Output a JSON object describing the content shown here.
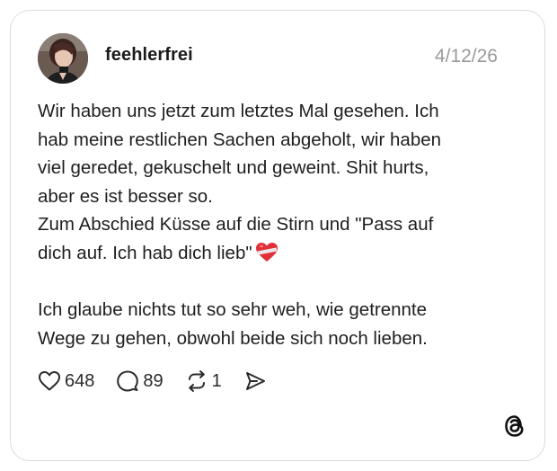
{
  "post": {
    "username": "feehlerfrei",
    "date": "4/12/26",
    "avatar_icon": "profile-photo",
    "lines": [
      "Wir haben uns jetzt zum letztes Mal gesehen. Ich",
      "hab meine restlichen Sachen abgeholt, wir haben",
      "viel geredet, gekuschelt und geweint. Shit hurts,",
      "aber es ist besser so.",
      "Zum Abschied Küsse auf die Stirn und \"Pass auf",
      "dich auf. Ich hab dich lieb\"",
      "",
      "Ich glaube nichts tut so sehr weh, wie getrennte",
      "Wege zu gehen, obwohl beide sich noch lieben."
    ],
    "emoji": "bandaged-heart-icon"
  },
  "actions": {
    "likes": "648",
    "comments": "89",
    "reposts": "1",
    "like_icon": "heart-outline-icon",
    "comment_icon": "speech-bubble-icon",
    "repost_icon": "repost-arrows-icon",
    "share_icon": "send-icon"
  },
  "brand": {
    "logo": "threads-logo-icon"
  }
}
